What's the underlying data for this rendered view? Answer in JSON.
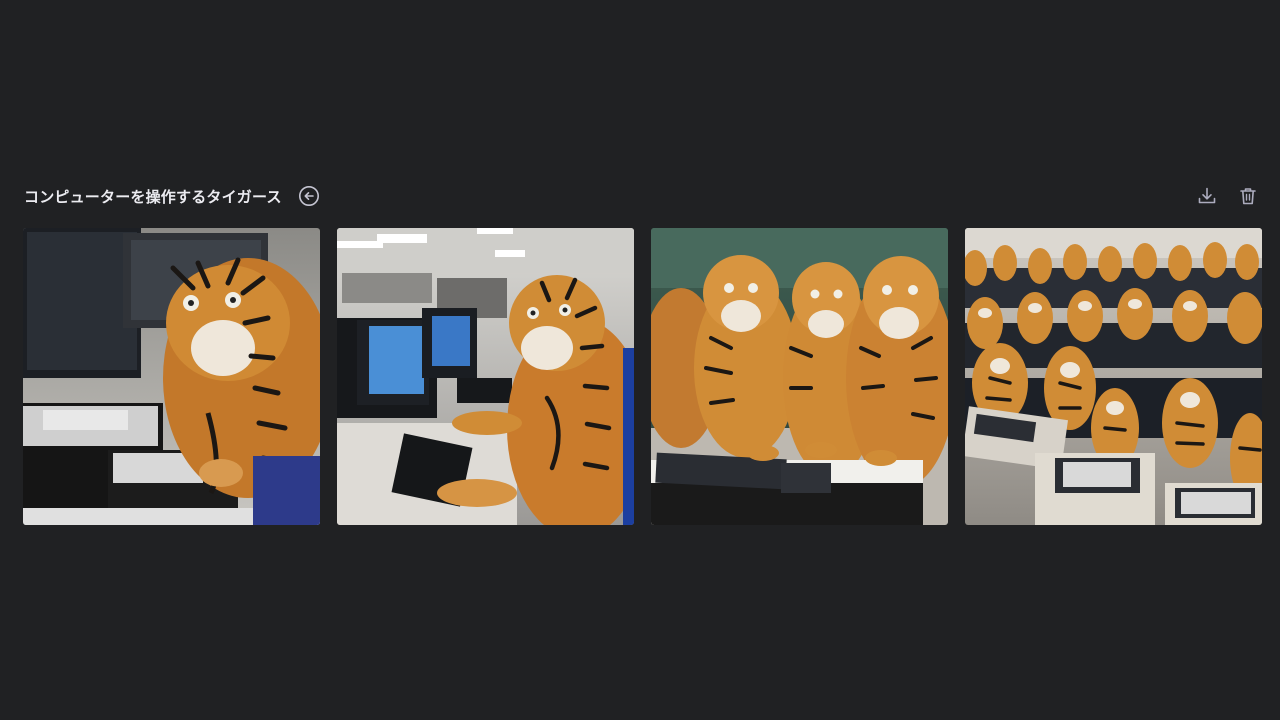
{
  "header": {
    "title": "コンピューターを操作するタイガース"
  },
  "toolbar": {
    "download_icon": "download-icon",
    "delete_icon": "trash-icon"
  },
  "images": [
    {
      "subject": "tiger at computer in office"
    },
    {
      "subject": "tiger at computer lab"
    },
    {
      "subject": "group of tigers at keyboard"
    },
    {
      "subject": "many tigers in computer room"
    }
  ],
  "colors": {
    "background": "#202123",
    "text": "#ececf1",
    "icon": "#acacbe"
  }
}
